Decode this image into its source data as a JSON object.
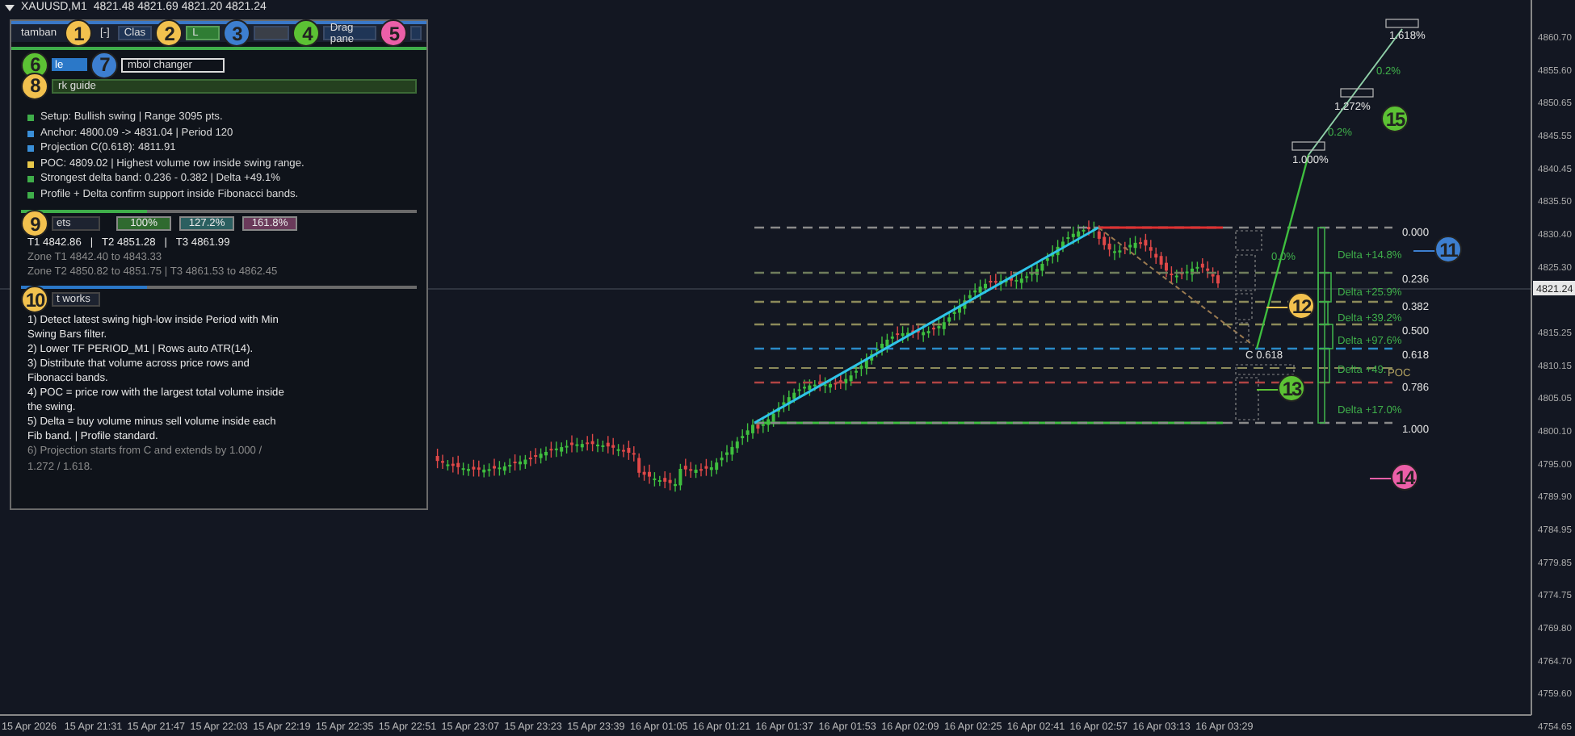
{
  "chart_header": {
    "symbol": "XAUUSD,M1",
    "ohlc": "4821.48 4821.69 4821.20 4821.24"
  },
  "toolbar": [
    {
      "label": "tamban",
      "kind": "text"
    },
    {
      "label": "[-]",
      "kind": "text"
    },
    {
      "label": "Clas",
      "kind": "blue"
    },
    {
      "label": "L",
      "kind": "green"
    },
    {
      "kind": "grey"
    },
    {
      "label": "Drag pane",
      "kind": "blue"
    }
  ],
  "symbol_row": {
    "button": "le",
    "field": "mbol changer"
  },
  "guide_bar": "rk guide",
  "summary": [
    {
      "text": "Setup: Bullish swing | Range 3095 pts.",
      "color": "#3fae4a"
    },
    {
      "text": "Anchor: 4800.09 -> 4831.04 | Period 120",
      "color": "#3a8fd8"
    },
    {
      "text": "Projection C(0.618): 4811.91",
      "color": "#3a8fd8"
    },
    {
      "text": "POC: 4809.02 | Highest volume row inside swing range.",
      "color": "#e8c84a"
    },
    {
      "text": "Strongest delta band: 0.236 - 0.382 | Delta +49.1%",
      "color": "#3fae4a"
    },
    {
      "text": "Profile + Delta confirm support inside Fibonacci bands.",
      "color": "#3fae4a"
    }
  ],
  "targets": {
    "tab": "ets",
    "tags": [
      {
        "label": "100%",
        "color": "#2f6a2f"
      },
      {
        "label": "127.2%",
        "color": "#2b5f60"
      },
      {
        "label": "161.8%",
        "color": "#6a3a5a"
      }
    ],
    "lines": [
      {
        "text": "T1 4842.86   |   T2 4851.28   |   T3 4861.99",
        "kind": "main"
      },
      {
        "text": "Zone T1 4842.40 to 4843.33",
        "kind": "muted"
      },
      {
        "text": "Zone T2 4850.82 to 4851.75 | T3 4861.53 to 4862.45",
        "kind": "muted"
      }
    ]
  },
  "how_it_works": {
    "tab": "t works",
    "steps": [
      {
        "text": "1) Detect latest swing high-low inside Period with Min Swing Bars filter.",
        "kind": "main"
      },
      {
        "text": "2) Lower TF PERIOD_M1 | Rows auto ATR(14).",
        "kind": "main"
      },
      {
        "text": "3) Distribute that volume across price rows and Fibonacci bands.",
        "kind": "main"
      },
      {
        "text": "4) POC = price row with the largest total volume inside the swing.",
        "kind": "main"
      },
      {
        "text": "5) Delta = buy volume minus sell volume inside each Fib band. | Profile standard.",
        "kind": "main"
      },
      {
        "text": "6) Projection starts from C and extends by 1.000 / 1.272 / 1.618.",
        "kind": "muted"
      }
    ]
  },
  "fib_levels": [
    {
      "label": "0.000",
      "color": "#8a8a8a"
    },
    {
      "label": "0.236",
      "color": "#6f7d5c"
    },
    {
      "label": "0.382",
      "color": "#8c8a5a"
    },
    {
      "label": "0.500",
      "color": "#8c8a5a"
    },
    {
      "label": "0.618",
      "color": "#2a8ac8"
    },
    {
      "label": "0.786",
      "color": "#b04444"
    },
    {
      "label": "1.000",
      "color": "#8a8a8a"
    }
  ],
  "delta_labels": [
    "Delta +14.8%",
    "Delta +25.9%",
    "Delta +39.2%",
    "Delta +97.6%",
    "Delta +49.",
    "Delta +17.0%"
  ],
  "poc_label": "POC",
  "zero_label": "0.0%",
  "c_label": "C 0.618",
  "projection_labels": [
    "1.000%",
    "1.272%",
    "1.618%"
  ],
  "projection_steps": [
    "0.2%",
    "0.2%"
  ],
  "price_axis": [
    "4860.70",
    "4855.60",
    "4850.65",
    "4845.55",
    "4840.45",
    "4835.50",
    "4830.40",
    "4825.30",
    "4815.25",
    "4810.15",
    "4805.05",
    "4800.10",
    "4795.00",
    "4789.90",
    "4784.95",
    "4779.85",
    "4774.75",
    "4769.80",
    "4764.70",
    "4759.60",
    "4754.65"
  ],
  "current_price": "4821.24",
  "time_axis": [
    "15 Apr 2026",
    "15 Apr 21:31",
    "15 Apr 21:47",
    "15 Apr 22:03",
    "15 Apr 22:19",
    "15 Apr 22:35",
    "15 Apr 22:51",
    "15 Apr 23:07",
    "15 Apr 23:23",
    "15 Apr 23:39",
    "16 Apr 01:05",
    "16 Apr 01:21",
    "16 Apr 01:37",
    "16 Apr 01:53",
    "16 Apr 02:09",
    "16 Apr 02:25",
    "16 Apr 02:41",
    "16 Apr 02:57",
    "16 Apr 03:13",
    "16 Apr 03:29"
  ],
  "markers": [
    {
      "number": "1",
      "color": "#f2c14e"
    },
    {
      "number": "2",
      "color": "#f2c14e"
    },
    {
      "number": "3",
      "color": "#3d7fd0"
    },
    {
      "number": "4",
      "color": "#5cc234"
    },
    {
      "number": "5",
      "color": "#ec5fa8"
    },
    {
      "number": "6",
      "color": "#5cc234"
    },
    {
      "number": "7",
      "color": "#3d7fd0"
    },
    {
      "number": "8",
      "color": "#f2c14e"
    },
    {
      "number": "9",
      "color": "#f2c14e"
    },
    {
      "number": "10",
      "color": "#f2c14e"
    },
    {
      "number": "11",
      "color": "#3d7fd0"
    },
    {
      "number": "12",
      "color": "#f2c14e"
    },
    {
      "number": "13",
      "color": "#5cc234"
    },
    {
      "number": "14",
      "color": "#ec5fa8"
    },
    {
      "number": "15",
      "color": "#5cc234"
    }
  ]
}
